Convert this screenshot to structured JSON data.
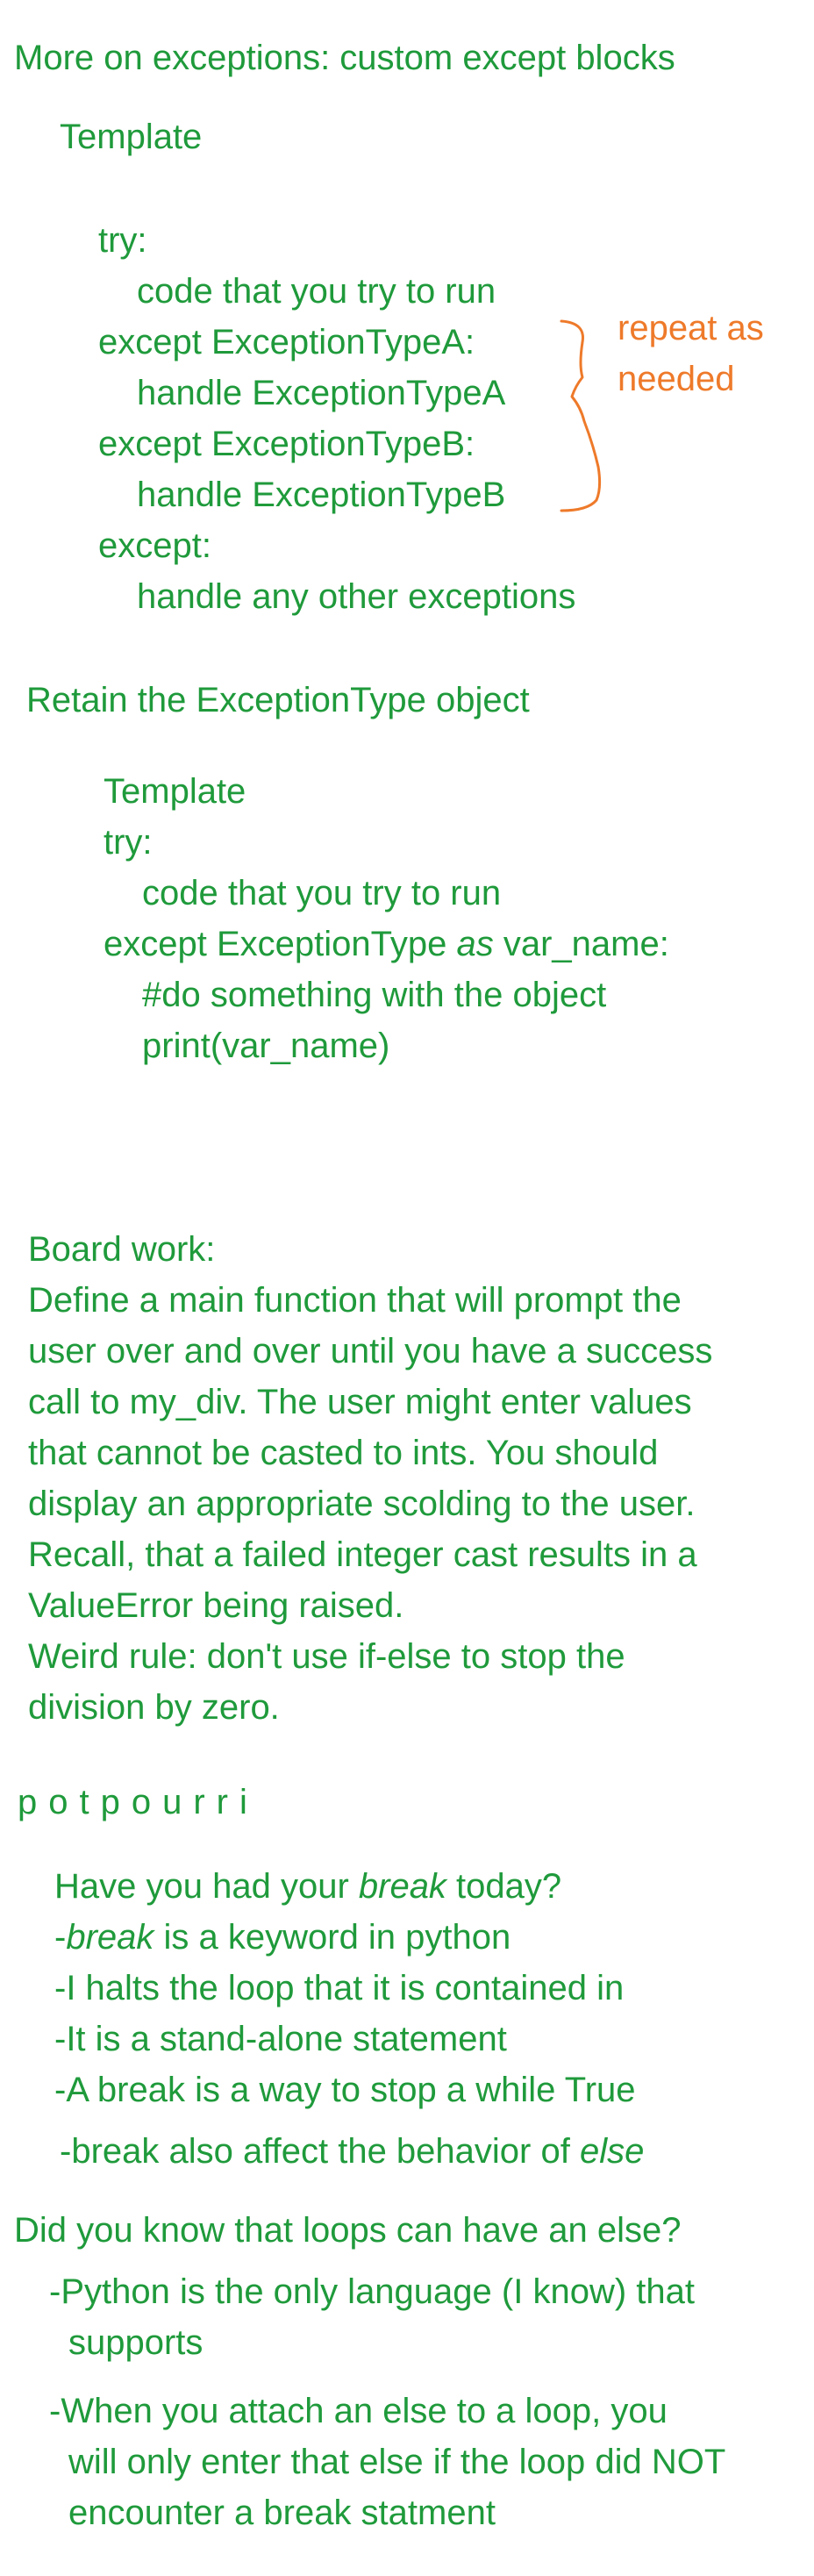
{
  "section1": {
    "title": "More on exceptions: custom except blocks",
    "template_label": "Template",
    "code": [
      "try:",
      "code that you try to run",
      "except ExceptionTypeA:",
      "handle ExceptionTypeA",
      "except ExceptionTypeB:",
      "handle ExceptionTypeB",
      "except:",
      "handle any other exceptions"
    ],
    "annotation": [
      "repeat as",
      "needed"
    ]
  },
  "section2": {
    "title": "Retain the ExceptionType object",
    "template_label": "Template",
    "code": [
      "try:",
      "code that you try to run",
      "except ExceptionType ",
      "as",
      " var_name:",
      "#do something with the object",
      "print(var_name)"
    ]
  },
  "board_work": {
    "lines": [
      "Board work:",
      "Define a main function that will prompt the",
      "user over and over until you have a success",
      "call to my_div. The user might enter values",
      "that cannot be casted to ints. You should",
      "display an appropriate scolding to the user.",
      "Recall, that a failed integer cast results in a",
      "ValueError being raised.",
      "Weird rule: don't use if-else to stop the",
      "division by zero."
    ]
  },
  "potpourri": {
    "title": "potpourri",
    "line1_a": "Have you had your ",
    "line1_em": "break",
    "line1_b": " today?",
    "line2_a": "-",
    "line2_em": "break",
    "line2_b": " is a keyword in python",
    "line3": "-I halts the loop that it is contained in",
    "line4": "-It is a stand-alone statement",
    "line5": "-A break is a way to stop a while True",
    "line6_a": "-break also affect the behavior of ",
    "line6_em": "else"
  },
  "loops_else": {
    "title": "Did you know that loops can have an else?",
    "lines": [
      "-Python is the only language (I know) that",
      "supports",
      "-When you attach an else to a loop, you",
      "will only enter that else if the loop did NOT",
      "encounter a break statment"
    ]
  },
  "colors": {
    "text_green": "#1f9a3b",
    "annotation_orange": "#ee7a2a",
    "background": "#ffffff"
  }
}
